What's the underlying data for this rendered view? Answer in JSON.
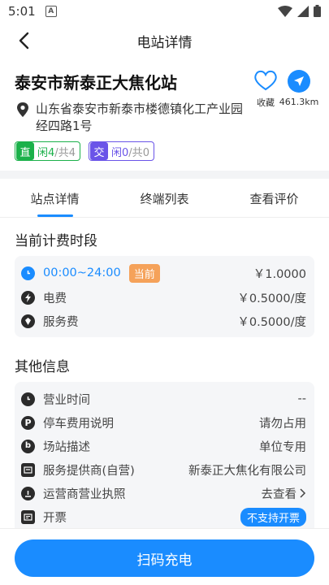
{
  "status_bar": {
    "time": "5:01",
    "notif_letter": "A"
  },
  "header": {
    "title": "电站详情"
  },
  "station": {
    "name": "泰安市新泰正大焦化站",
    "address": "山东省泰安市新泰市楼德镇化工产业园经四路1号",
    "favorite_label": "收藏",
    "distance": "461.3km",
    "dc": {
      "type": "直",
      "free_label": "闲",
      "free": "4",
      "sep": "/",
      "total_label": "共",
      "total": "4"
    },
    "ac": {
      "type": "交",
      "free_label": "闲",
      "free": "0",
      "sep": "/",
      "total_label": "共",
      "total": "0"
    }
  },
  "tabs": [
    "站点详情",
    "终端列表",
    "查看评价"
  ],
  "billing": {
    "title": "当前计费时段",
    "period": "00:00~24:00",
    "current_badge": "当前",
    "total_price": "￥1.0000",
    "rows": [
      {
        "label": "电费",
        "value": "￥0.5000/度"
      },
      {
        "label": "服务费",
        "value": "￥0.5000/度"
      }
    ]
  },
  "other": {
    "title": "其他信息",
    "rows": [
      {
        "label": "营业时间",
        "value": "--"
      },
      {
        "label": "停车费用说明",
        "value": "请勿占用"
      },
      {
        "label": "场站描述",
        "value": "单位专用"
      },
      {
        "label": "服务提供商(自营)",
        "value": "新泰正大焦化有限公司"
      },
      {
        "label": "运营商营业执照",
        "value": "去查看"
      },
      {
        "label": "开票",
        "value": "不支持开票"
      }
    ]
  },
  "actions": {
    "scan_charge": "扫码充电"
  },
  "colors": {
    "accent": "#1a8cff",
    "dc_green": "#1bb14a",
    "ac_purple": "#6a54e8",
    "badge_orange": "#f5a25a"
  }
}
